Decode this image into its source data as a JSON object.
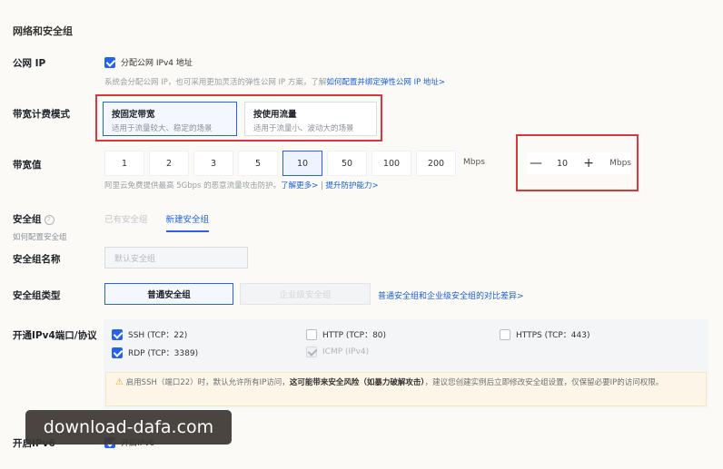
{
  "section_title": "网络和安全组",
  "public_ip": {
    "label": "公网 IP",
    "checkbox_label": "分配公网 IPv4 地址",
    "hint": "系统会分配公网 IP，也可采用更加灵活的弹性公网 IP 方案，了解",
    "hint_link": "如何配置并绑定弹性公网 IP 地址>"
  },
  "billing": {
    "label": "带宽计费模式",
    "options": [
      {
        "title": "按固定带宽",
        "desc": "适用于流量较大、稳定的场景"
      },
      {
        "title": "按使用流量",
        "desc": "适用于流量小、波动大的场景"
      }
    ]
  },
  "bandwidth": {
    "label": "带宽值",
    "options": [
      "1",
      "2",
      "3",
      "5",
      "10",
      "50",
      "100",
      "200"
    ],
    "selected": "10",
    "unit": "Mbps",
    "stepper_minus": "—",
    "stepper_value": "10",
    "stepper_plus": "+",
    "stepper_unit": "Mbps",
    "hint": "阿里云免费提供最高 5Gbps 的恶意流量攻击防护。",
    "hint_link1": "了解更多>",
    "hint_sep": "|",
    "hint_link2": "提升防护能力>"
  },
  "security_group": {
    "label": "安全组",
    "help": "?",
    "sub_label": "如何配置安全组",
    "tabs": [
      "已有安全组",
      "新建安全组"
    ],
    "active_tab": "新建安全组"
  },
  "sg_name": {
    "label": "安全组名称",
    "placeholder": "默认安全组"
  },
  "sg_type": {
    "label": "安全组类型",
    "options": [
      "普通安全组",
      "企业级安全组"
    ],
    "link": "普通安全组和企业级安全组的对比差异>"
  },
  "ports": {
    "label": "开通IPv4端口/协议",
    "items": [
      {
        "label": "SSH (TCP：22)",
        "checked": true
      },
      {
        "label": "HTTP (TCP：80)",
        "checked": false
      },
      {
        "label": "HTTPS (TCP：443)",
        "checked": false
      },
      {
        "label": "RDP (TCP：3389)",
        "checked": true
      },
      {
        "label": "ICMP (IPv4)",
        "checked": true,
        "disabled": true
      }
    ],
    "warning_prefix": "启用SSH（端口22）时，默认允许所有IP访问，",
    "warning_bold": "这可能带来安全风险（如暴力破解攻击）",
    "warning_suffix": "，建议您创建实例后立即修改安全组设置，仅保留必要IP的访问权限。"
  },
  "ipv6": {
    "label": "开启IPv6",
    "checkbox_label": "开启IPv6"
  },
  "watermark": "download-dafa.com",
  "colors": {
    "accent": "#2563eb",
    "highlight_border": "#d9363e",
    "link": "#1a5fd8"
  }
}
